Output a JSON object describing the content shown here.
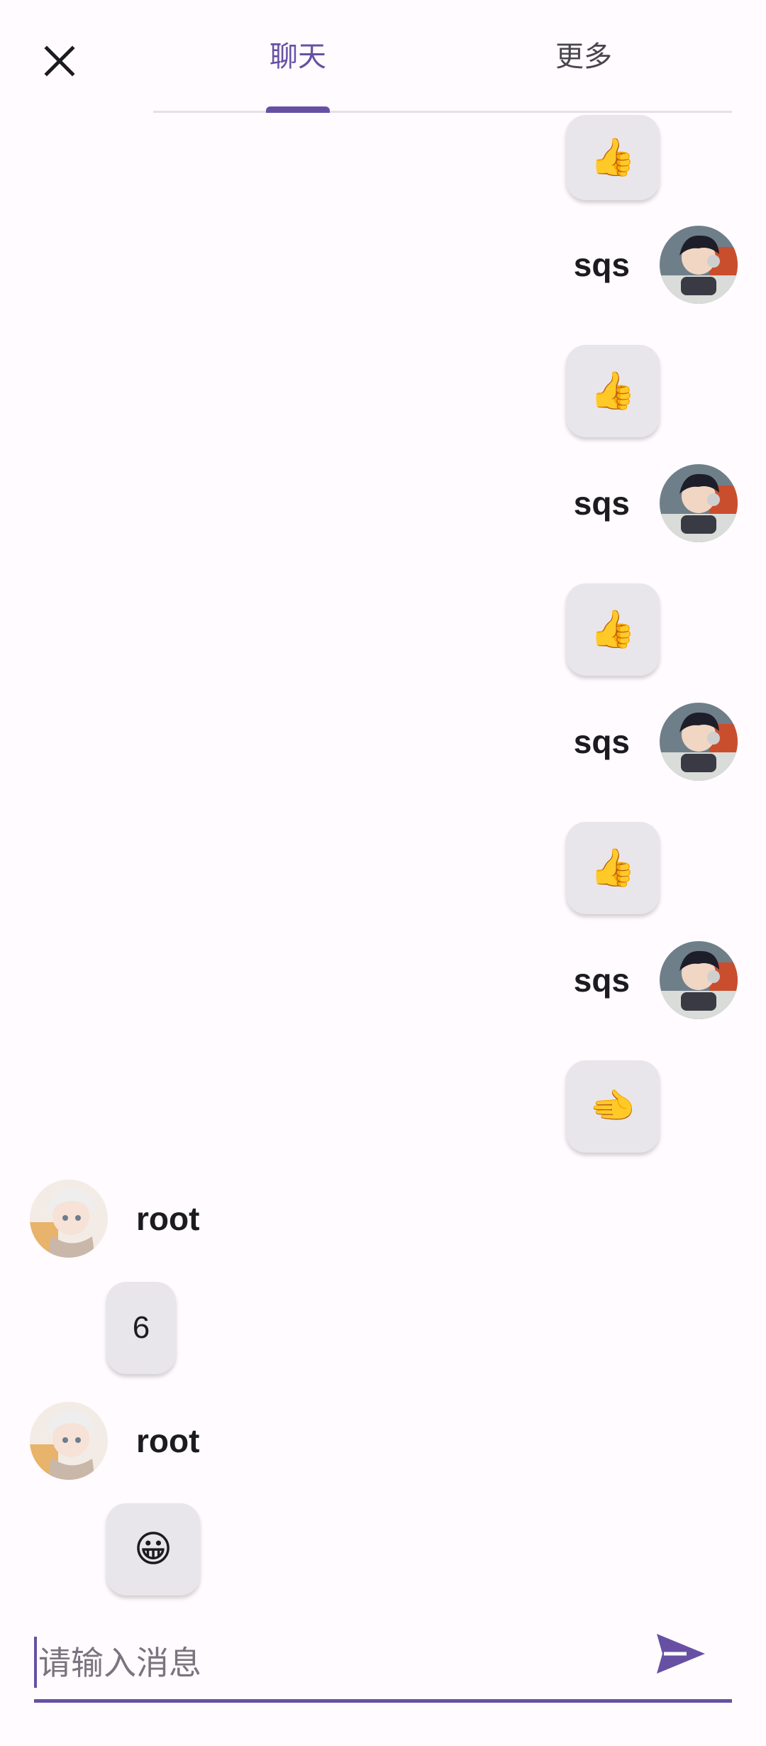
{
  "header": {
    "close_icon": "close-icon",
    "tabs": [
      {
        "label": "聊天",
        "active": true
      },
      {
        "label": "更多",
        "active": false
      }
    ],
    "accent_color": "#6750a4"
  },
  "messages": [
    {
      "sender": "",
      "side": "right",
      "content": "👍",
      "partial": true
    },
    {
      "sender": "sqs",
      "side": "right",
      "avatar": "avatar-boy-headphones",
      "content": "👍"
    },
    {
      "sender": "sqs",
      "side": "right",
      "avatar": "avatar-boy-headphones",
      "content": "👍"
    },
    {
      "sender": "sqs",
      "side": "right",
      "avatar": "avatar-boy-headphones",
      "content": "👍"
    },
    {
      "sender": "sqs",
      "side": "right",
      "avatar": "avatar-boy-headphones",
      "content": "🫲"
    },
    {
      "sender": "root",
      "side": "left",
      "avatar": "avatar-white-hair",
      "content": "6"
    },
    {
      "sender": "root",
      "side": "left",
      "avatar": "avatar-white-hair",
      "content": "😀"
    }
  ],
  "composer": {
    "placeholder": "请输入消息",
    "value": "",
    "send_icon": "send-icon"
  }
}
